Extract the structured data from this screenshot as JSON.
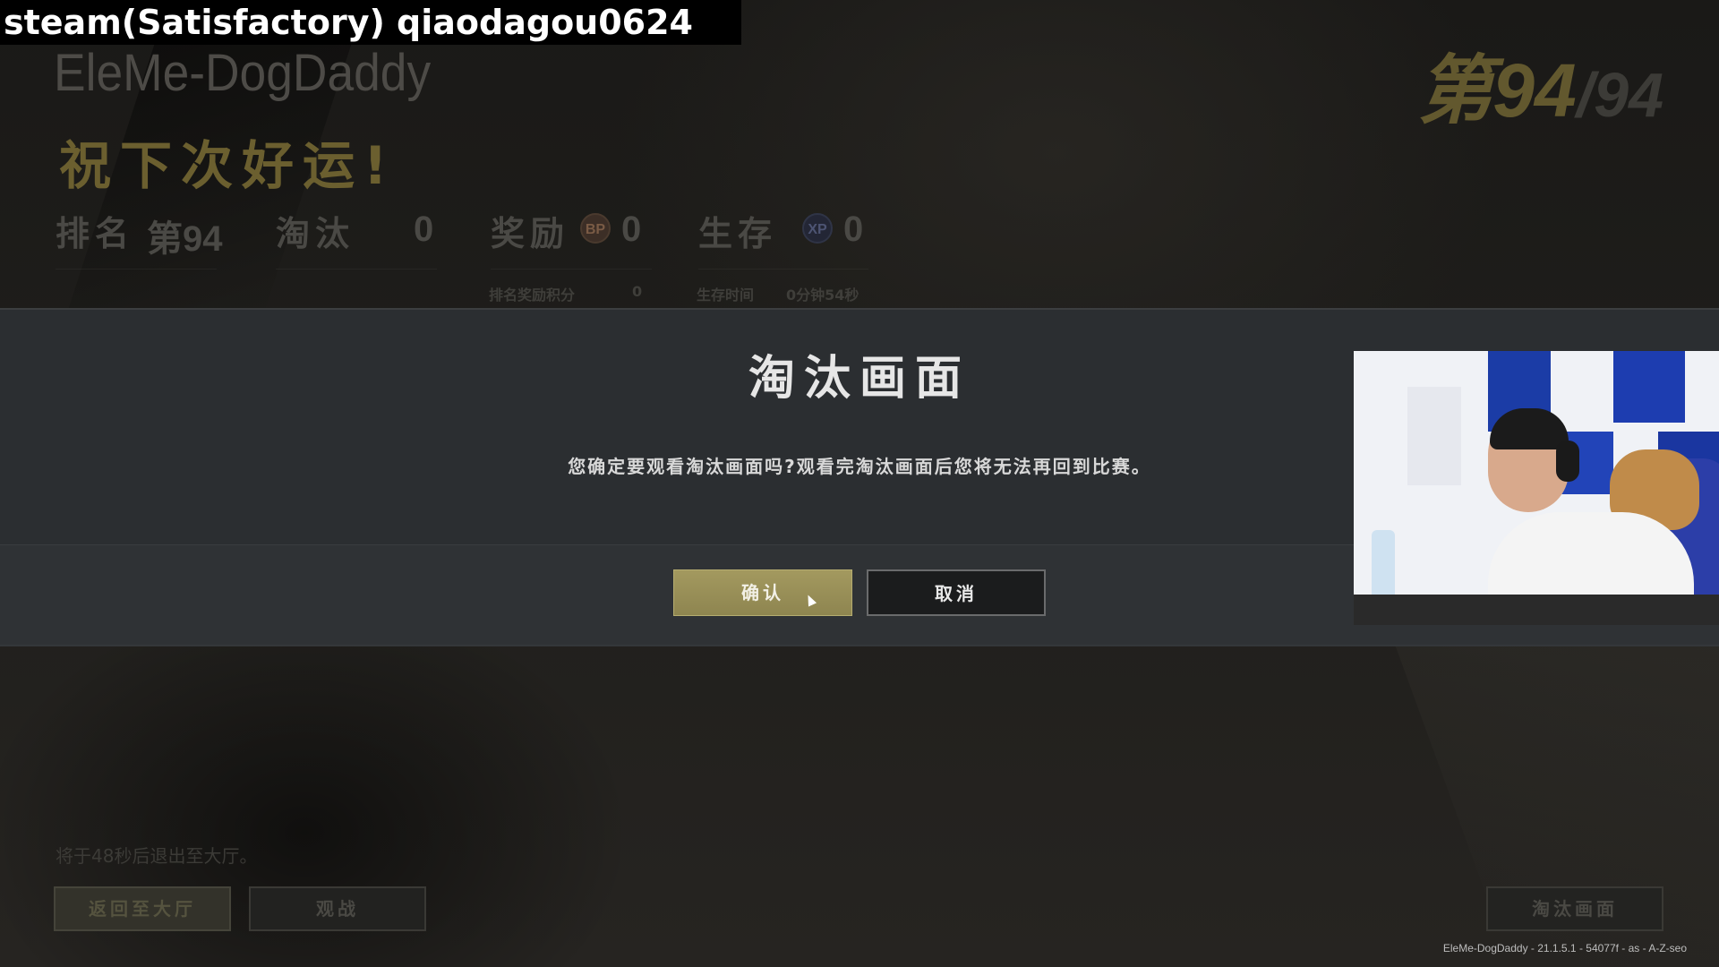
{
  "watermark": "steam(Satisfactory) qiaodagou0624",
  "header": {
    "player_name": "EleMe-DogDaddy",
    "good_luck": "祝下次好运!",
    "rank_current": "第94",
    "rank_total": "/94"
  },
  "stats": {
    "rank_label": "排名",
    "rank_value": "第94",
    "kills_label": "淘汰",
    "kills_value": "0",
    "reward_label": "奖励",
    "bp_icon": "BP",
    "reward_value": "0",
    "survival_label": "生存",
    "xp_icon": "XP",
    "survival_value": "0",
    "rank_bp_label": "排名奖励积分",
    "rank_bp_value": "0",
    "survival_time_label": "生存时间",
    "survival_time_value": "0分钟54秒"
  },
  "dialog": {
    "title": "淘汰画面",
    "message": "您确定要观看淘汰画面吗?观看完淘汰画面后您将无法再回到比赛。",
    "confirm_label": "确认",
    "cancel_label": "取消"
  },
  "bottom": {
    "exit_note": "将于48秒后退出至大厅。",
    "return_lobby_label": "返回至大厅",
    "spectate_label": "观战",
    "elim_screen_label": "淘汰画面",
    "build_info": "EleMe-DogDaddy - 21.1.5.1 - 54077f - as - A-Z-seo"
  }
}
